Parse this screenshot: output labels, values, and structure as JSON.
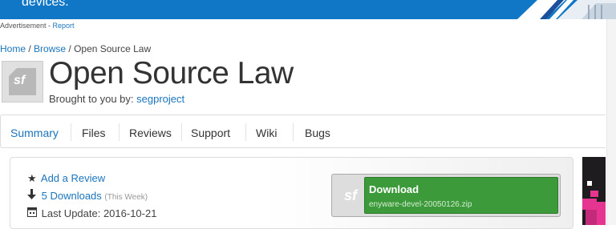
{
  "ad_banner": {
    "text": "devices."
  },
  "ad_line": {
    "label": "Advertisement",
    "sep": " - ",
    "report": "Report"
  },
  "breadcrumb": {
    "items": [
      "Home",
      "Browse"
    ],
    "sep": " / ",
    "current": "Open Source Law"
  },
  "project": {
    "title": "Open Source Law",
    "logo_text": "sf",
    "brought_prefix": "Brought to you by:",
    "author": "segproject"
  },
  "tabs": [
    "Summary",
    "Files",
    "Reviews",
    "Support",
    "Wiki",
    "Bugs"
  ],
  "stats": {
    "add_review": "Add a Review",
    "downloads": "5 Downloads",
    "downloads_period": "(This Week)",
    "last_update": "Last Update: 2016-10-21"
  },
  "download": {
    "logo_text": "sf",
    "label": "Download",
    "file": "enyware-devel-20050126.zip"
  },
  "colors": {
    "link": "#1b75bc",
    "download_green": "#3c9a3a",
    "banner_blue": "#0f77c5"
  }
}
